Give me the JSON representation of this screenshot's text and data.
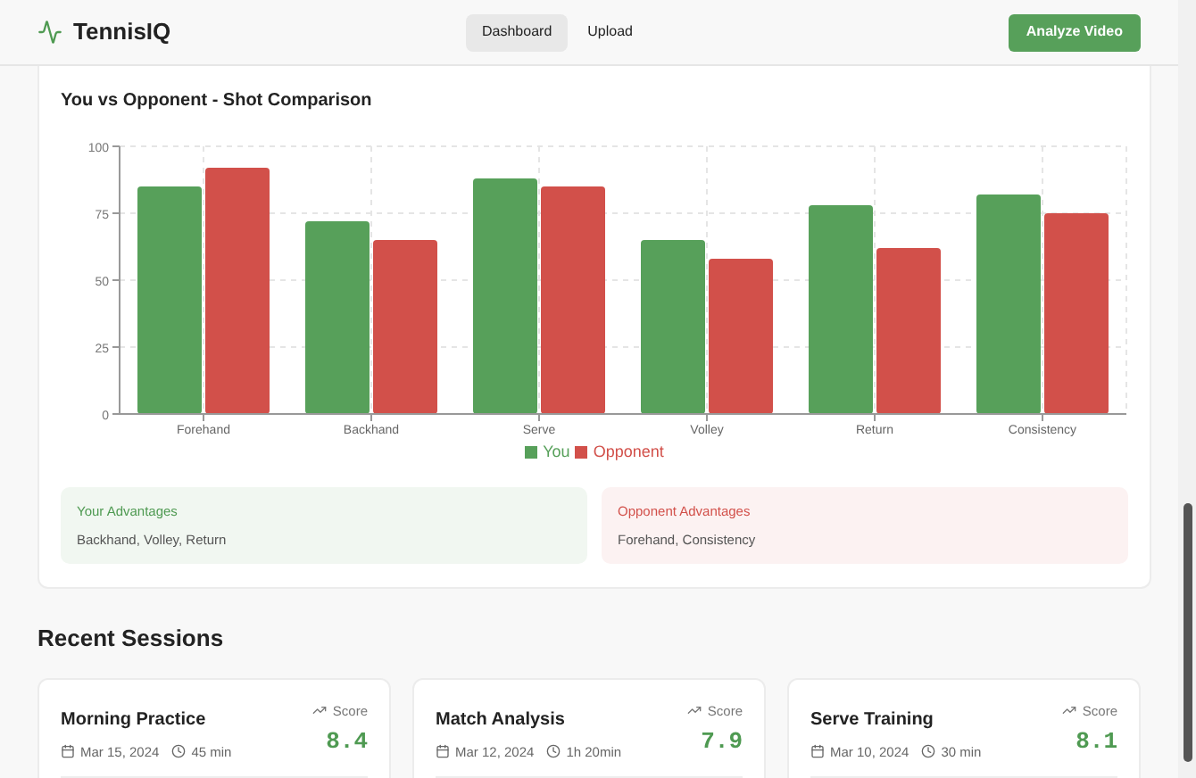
{
  "header": {
    "brand": "TennisIQ",
    "nav": [
      {
        "label": "Dashboard",
        "selected": true
      },
      {
        "label": "Upload",
        "selected": false
      }
    ],
    "action": "Analyze Video"
  },
  "comparison": {
    "title": "You vs Opponent - Shot Comparison",
    "chart_data": {
      "type": "bar",
      "categories": [
        "Forehand",
        "Backhand",
        "Serve",
        "Volley",
        "Return",
        "Consistency"
      ],
      "series": [
        {
          "name": "You",
          "color": "#57a05a",
          "values": [
            85,
            72,
            88,
            65,
            78,
            82
          ]
        },
        {
          "name": "Opponent",
          "color": "#d2504a",
          "values": [
            92,
            65,
            85,
            58,
            62,
            75
          ]
        }
      ],
      "ylim": [
        0,
        100
      ],
      "grid": true,
      "yticks": [
        0,
        25,
        50,
        75,
        100
      ]
    },
    "advantages": [
      {
        "kind": "you",
        "title": "Your Advantages",
        "items": "Backhand, Volley, Return"
      },
      {
        "kind": "opponent",
        "title": "Opponent Advantages",
        "items": "Forehand, Consistency"
      }
    ]
  },
  "sessions": {
    "title": "Recent Sessions",
    "items": [
      {
        "name": "Morning Practice",
        "date": "Mar 15, 2024",
        "duration": "45 min",
        "score_label": "Score",
        "score": "8.4"
      },
      {
        "name": "Match Analysis",
        "date": "Mar 12, 2024",
        "duration": "1h 20min",
        "score_label": "Score",
        "score": "7.9"
      },
      {
        "name": "Serve Training",
        "date": "Mar 10, 2024",
        "duration": "30 min",
        "score_label": "Score",
        "score": "8.1"
      }
    ]
  }
}
